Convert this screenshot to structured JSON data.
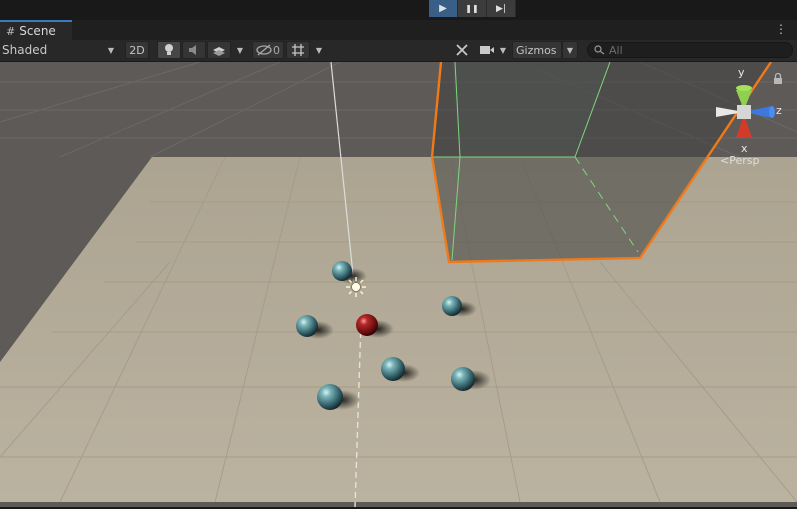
{
  "playbar": {
    "buttons": [
      {
        "name": "play-button",
        "glyph": "▶",
        "active": true
      },
      {
        "name": "pause-button",
        "glyph": "❚❚",
        "active": false
      },
      {
        "name": "step-button",
        "glyph": "▶|",
        "active": false
      }
    ]
  },
  "tab": {
    "icon": "#",
    "title": "Scene"
  },
  "toolbar": {
    "shading_mode": "Shaded",
    "mode_2d": "2D",
    "hidden_count": "0",
    "gizmos_label": "Gizmos",
    "search_placeholder": "All"
  },
  "orientation_gizmo": {
    "y_label": "y",
    "z_label": "z",
    "x_label": "x",
    "projection_label": "Persp"
  },
  "scene": {
    "spheres": [
      {
        "color": "#5f9aa0"
      },
      {
        "color": "#5f9aa0"
      },
      {
        "color": "#5f9aa0"
      },
      {
        "color": "#5f9aa0"
      },
      {
        "color": "#5f9aa0"
      },
      {
        "color": "#5f9aa0"
      },
      {
        "color": "#a32020"
      }
    ],
    "selection_color": "#f07a1a",
    "collider_color": "#7fd67f",
    "floor_color": "#b4ac99",
    "background_color": "#5d5a58"
  }
}
